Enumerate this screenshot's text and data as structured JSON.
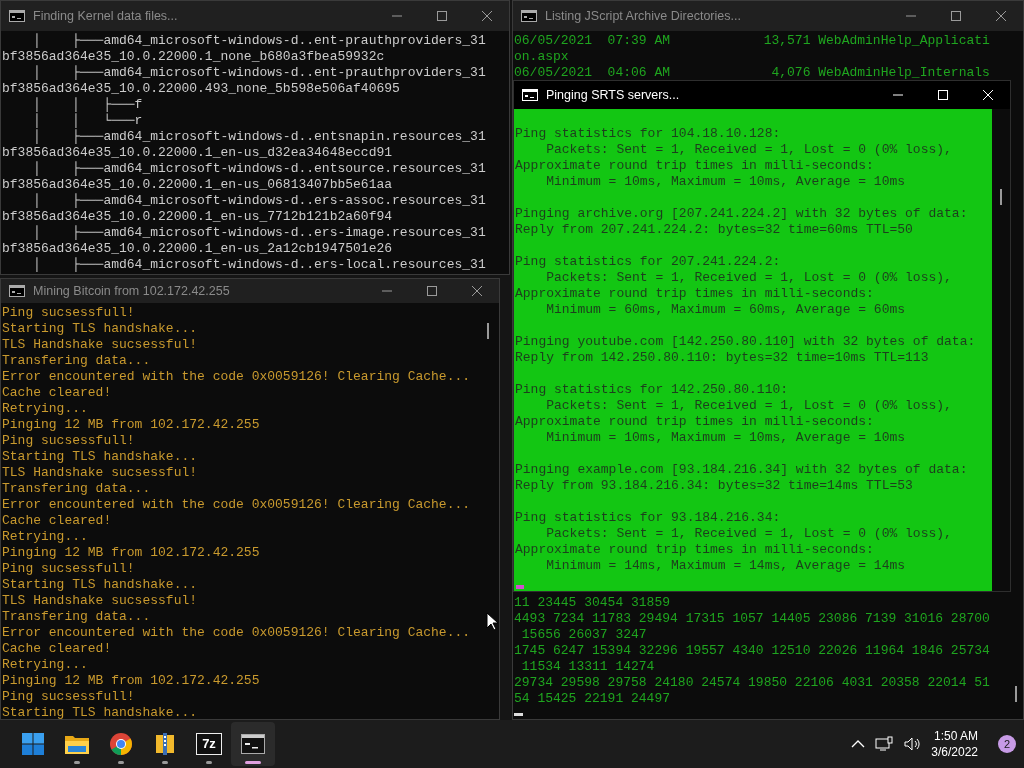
{
  "windows": [
    {
      "kind": "tree",
      "title": "Finding Kernel data files...",
      "active": false,
      "lines": [
        "    │    ├───amd64_microsoft-windows-d..ent-prauthproviders_31",
        "bf3856ad364e35_10.0.22000.1_none_b680a3fbea59932c",
        "    │    ├───amd64_microsoft-windows-d..ent-prauthproviders_31",
        "bf3856ad364e35_10.0.22000.493_none_5b598e506af40695",
        "    │    │   ├───f",
        "    │    │   └───r",
        "    │    ├───amd64_microsoft-windows-d..entsnapin.resources_31",
        "bf3856ad364e35_10.0.22000.1_en-us_d32ea34648eccd91",
        "    │    ├───amd64_microsoft-windows-d..entsource.resources_31",
        "bf3856ad364e35_10.0.22000.1_en-us_06813407bb5e61aa",
        "    │    ├───amd64_microsoft-windows-d..ers-assoc.resources_31",
        "bf3856ad364e35_10.0.22000.1_en-us_7712b121b2a60f94",
        "    │    ├───amd64_microsoft-windows-d..ers-image.resources_31",
        "bf3856ad364e35_10.0.22000.1_en-us_2a12cb1947501e26",
        "    │    ├───amd64_microsoft-windows-d..ers-local.resources_31"
      ]
    },
    {
      "kind": "listing",
      "title": "Listing JScript Archive Directories...",
      "active": false,
      "lines": [
        "06/05/2021  07:39 AM            13,571 WebAdminHelp_Applicati",
        "on.aspx",
        "06/05/2021  04:06 AM             4,076 WebAdminHelp_Internals"
      ],
      "tail_lines": [
        "11 23445 30454 31859",
        "4493 7234 11783 29494 17315 1057 14405 23086 7139 31016 28700",
        " 15656 26037 3247",
        "1745 6247 15394 32296 19557 4340 12510 22026 11964 1846 25734",
        " 11534 13311 14274",
        "29734 29598 29758 24180 24574 19850 22106 4031 20358 22014 51",
        "54 15425 22191 24497"
      ]
    },
    {
      "kind": "log",
      "title": "Mining Bitcoin from 102.172.42.255",
      "active": false,
      "lines": [
        "Ping sucsessfull!",
        "Starting TLS handshake...",
        "TLS Handshake sucsessful!",
        "Transfering data...",
        "Error encountered with the code 0x0059126! Clearing Cache...",
        "Cache cleared!",
        "Retrying...",
        "Pinging 12 MB from 102.172.42.255",
        "Ping sucsessfull!",
        "Starting TLS handshake...",
        "TLS Handshake sucsessful!",
        "Transfering data...",
        "Error encountered with the code 0x0059126! Clearing Cache...",
        "Cache cleared!",
        "Retrying...",
        "Pinging 12 MB from 102.172.42.255",
        "Ping sucsessfull!",
        "Starting TLS handshake...",
        "TLS Handshake sucsessful!",
        "Transfering data...",
        "Error encountered with the code 0x0059126! Clearing Cache...",
        "Cache cleared!",
        "Retrying...",
        "Pinging 12 MB from 102.172.42.255",
        "Ping sucsessfull!",
        "Starting TLS handshake..."
      ]
    },
    {
      "kind": "ping",
      "title": "Pinging SRTS servers...",
      "active": true,
      "blocks": [
        [
          "Ping statistics for 104.18.10.128:",
          "    Packets: Sent = 1, Received = 1, Lost = 0 (0% loss),",
          "Approximate round trip times in milli-seconds:",
          "    Minimum = 10ms, Maximum = 10ms, Average = 10ms"
        ],
        [
          "Pinging archive.org [207.241.224.2] with 32 bytes of data:",
          "Reply from 207.241.224.2: bytes=32 time=60ms TTL=50"
        ],
        [
          "Ping statistics for 207.241.224.2:",
          "    Packets: Sent = 1, Received = 1, Lost = 0 (0% loss),",
          "Approximate round trip times in milli-seconds:",
          "    Minimum = 60ms, Maximum = 60ms, Average = 60ms"
        ],
        [
          "Pinging youtube.com [142.250.80.110] with 32 bytes of data:",
          "Reply from 142.250.80.110: bytes=32 time=10ms TTL=113"
        ],
        [
          "Ping statistics for 142.250.80.110:",
          "    Packets: Sent = 1, Received = 1, Lost = 0 (0% loss),",
          "Approximate round trip times in milli-seconds:",
          "    Minimum = 10ms, Maximum = 10ms, Average = 10ms"
        ],
        [
          "Pinging example.com [93.184.216.34] with 32 bytes of data:",
          "Reply from 93.184.216.34: bytes=32 time=14ms TTL=53"
        ],
        [
          "Ping statistics for 93.184.216.34:",
          "    Packets: Sent = 1, Received = 1, Lost = 0 (0% loss),",
          "Approximate round trip times in milli-seconds:",
          "    Minimum = 14ms, Maximum = 14ms, Average = 14ms"
        ]
      ]
    }
  ],
  "taskbar": {
    "apps": [
      {
        "kind": "start",
        "running": false,
        "selected": false
      },
      {
        "kind": "folder",
        "running": true,
        "selected": false
      },
      {
        "kind": "browser",
        "running": true,
        "selected": false
      },
      {
        "kind": "archive",
        "running": true,
        "selected": false
      },
      {
        "kind": "sevenzip",
        "label": "7z",
        "running": true,
        "selected": false
      },
      {
        "kind": "terminal",
        "running": true,
        "selected": true
      }
    ],
    "time": "1:50 AM",
    "date": "3/6/2022",
    "notifications": "2"
  }
}
